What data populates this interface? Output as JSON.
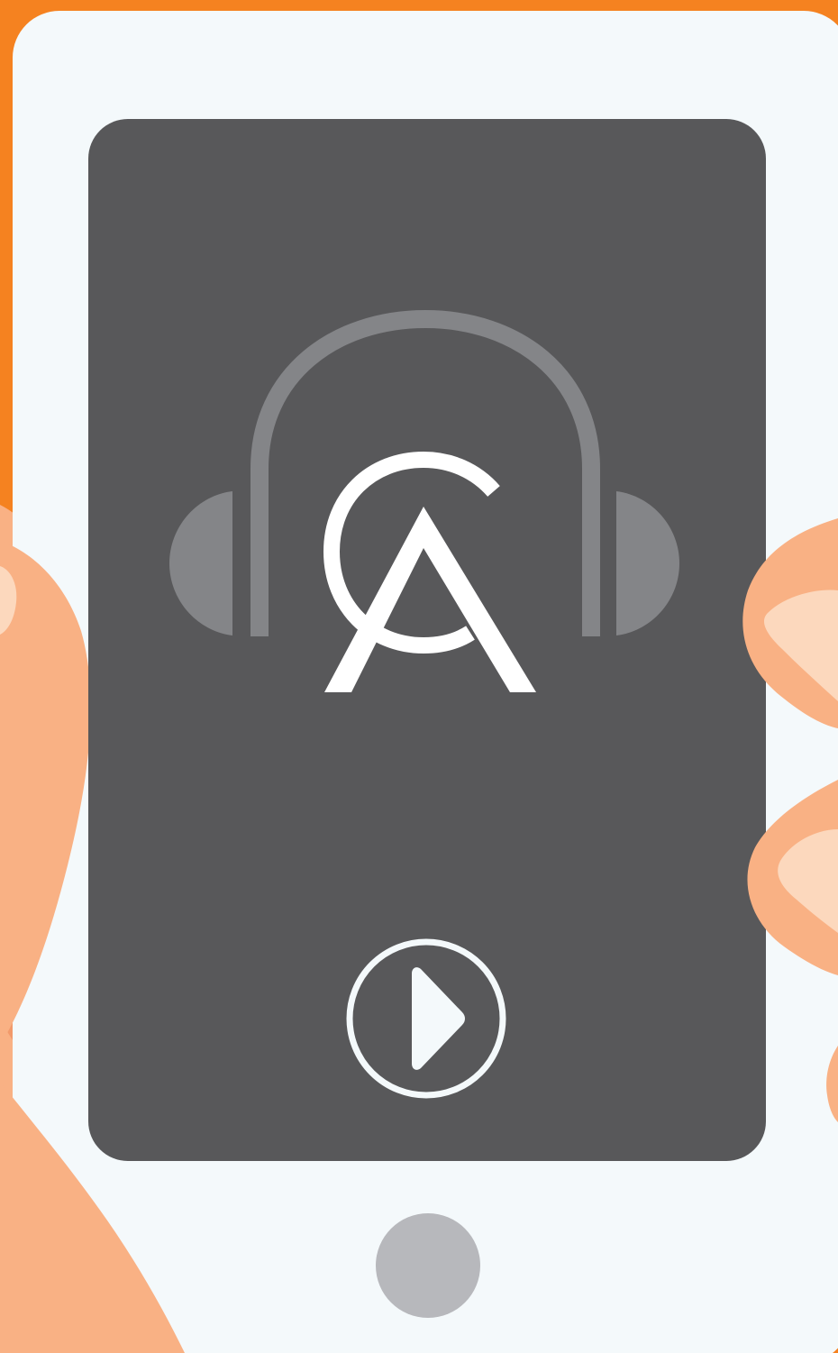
{
  "colors": {
    "background": "#F58220",
    "phone_body": "#F4F9FB",
    "screen": "#58585A",
    "headphones": "#848588",
    "logo": "#FFFFFF",
    "home_button": "#B7B8BC",
    "skin": "#F9B184",
    "skin_light": "#FCD8BD",
    "skin_shadow": "#F29A6B"
  },
  "icons": {
    "logo": "ca-monogram-headphones-icon",
    "play": "play-icon",
    "home": "home-button"
  },
  "player": {
    "playing": false
  }
}
